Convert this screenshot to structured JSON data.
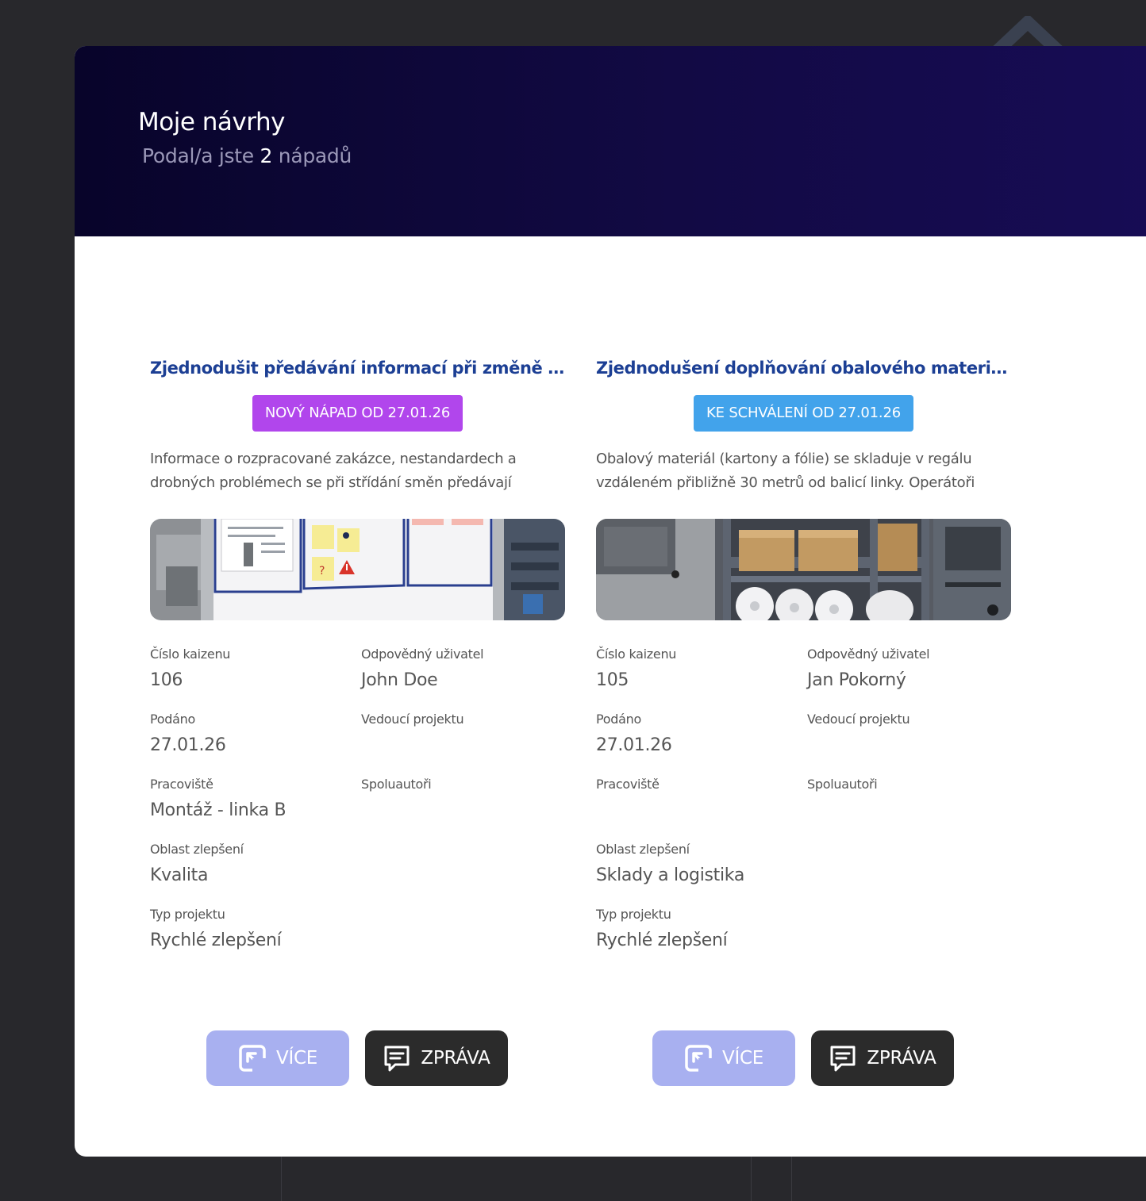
{
  "header": {
    "title": "Moje návrhy",
    "subtitle_prefix": "Podal/a jste",
    "ideas_count": "2",
    "subtitle_suffix": "nápadů"
  },
  "colors": {
    "badge_new": "#b146ec",
    "badge_approval": "#42a3eb",
    "title": "#1c3f94",
    "btn_more": "#a8b0f0",
    "btn_message": "#2b2b2b"
  },
  "labels": {
    "kaizen_number": "Číslo kaizenu",
    "responsible_user": "Odpovědný uživatel",
    "submitted": "Podáno",
    "project_lead": "Vedoucí projektu",
    "workplace": "Pracoviště",
    "coauthors": "Spoluautoři",
    "improvement_area": "Oblast zlepšení",
    "project_type": "Typ projektu",
    "more_button": "VÍCE",
    "message_button": "ZPRÁVA"
  },
  "cards": [
    {
      "title": "Zjednodušit předávání informací při změně směn…",
      "badge": "NOVÝ NÁPAD OD 27.01.26",
      "badge_status": "new",
      "description": "Informace o rozpracované zakázce, nestandardech a drobných problémech se při střídání směn předávají převážně ústně.…",
      "image_icon": "whiteboard-image",
      "kaizen_number": "106",
      "responsible_user": "John Doe",
      "submitted": "27.01.26",
      "project_lead": "",
      "workplace": "Montáž - linka B",
      "coauthors": "",
      "improvement_area": "Kvalita",
      "project_type": "Rychlé zlepšení"
    },
    {
      "title": "Zjednodušení doplňování obalového materiálu u …",
      "badge": "KE SCHVÁLENÍ OD 27.01.26",
      "badge_status": "approval",
      "description": "Obalový materiál (kartony a fólie) se skladuje v regálu vzdáleném přibližně 30 metrů od balicí linky. Operátoři musí…",
      "image_icon": "warehouse-shelf-image",
      "kaizen_number": "105",
      "responsible_user": "Jan Pokorný",
      "submitted": "27.01.26",
      "project_lead": "",
      "workplace": "",
      "coauthors": "",
      "improvement_area": "Sklady a logistika",
      "project_type": "Rychlé zlepšení"
    }
  ]
}
